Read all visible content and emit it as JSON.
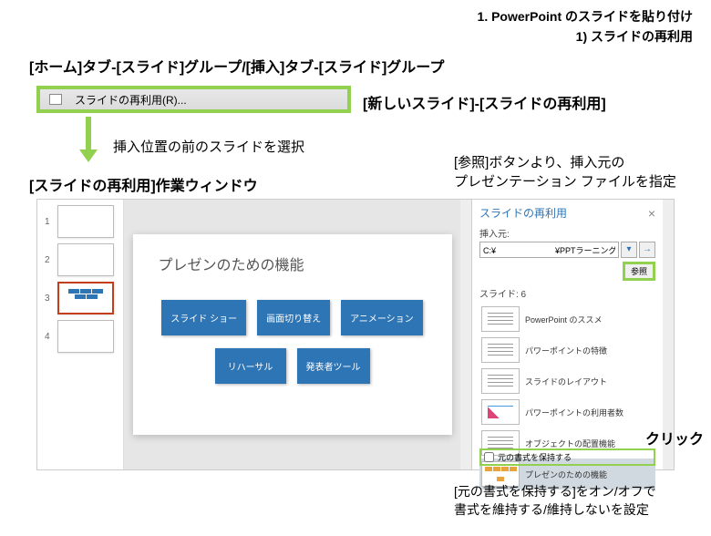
{
  "header": {
    "line1": "1. PowerPoint のスライドを貼り付け",
    "line2": "1) スライドの再利用"
  },
  "ribbon_path": "[ホーム]タブ-[スライド]グループ/[挿入]タブ-[スライド]グループ",
  "menu_item": "スライドの再利用(R)...",
  "new_slide_path": "[新しいスライド]-[スライドの再利用]",
  "select_prev": "挿入位置の前のスライドを選択",
  "browse_note": "[参照]ボタンより、挿入元の\nプレゼンテーション ファイルを指定",
  "pane_title_label": "[スライドの再利用]作業ウィンドウ",
  "thumbnails": [
    {
      "num": "1"
    },
    {
      "num": "2"
    },
    {
      "num": "3",
      "selected": true
    },
    {
      "num": "4"
    }
  ],
  "slide": {
    "title": "プレゼンのための機能",
    "row1": [
      "スライド ショー",
      "画面切り替え",
      "アニメーション"
    ],
    "row2": [
      "リハーサル",
      "発表者ツール"
    ]
  },
  "reuse": {
    "title": "スライドの再利用",
    "insert_from": "挿入元:",
    "path": "C:¥                          ¥PPTラーニング¥Pl",
    "browse": "参照",
    "count": "スライド: 6",
    "items": [
      "PowerPoint のススメ",
      "パワーポイントの特徴",
      "スライドのレイアウト",
      "パワーポイントの利用者数",
      "オブジェクトの配置機能",
      "プレゼンのための機能"
    ],
    "keep_format": "元の書式を保持する"
  },
  "click_label": "クリック",
  "bottom_note": "[元の書式を保持する]をオン/オフで\n書式を維持する/維持しないを設定"
}
